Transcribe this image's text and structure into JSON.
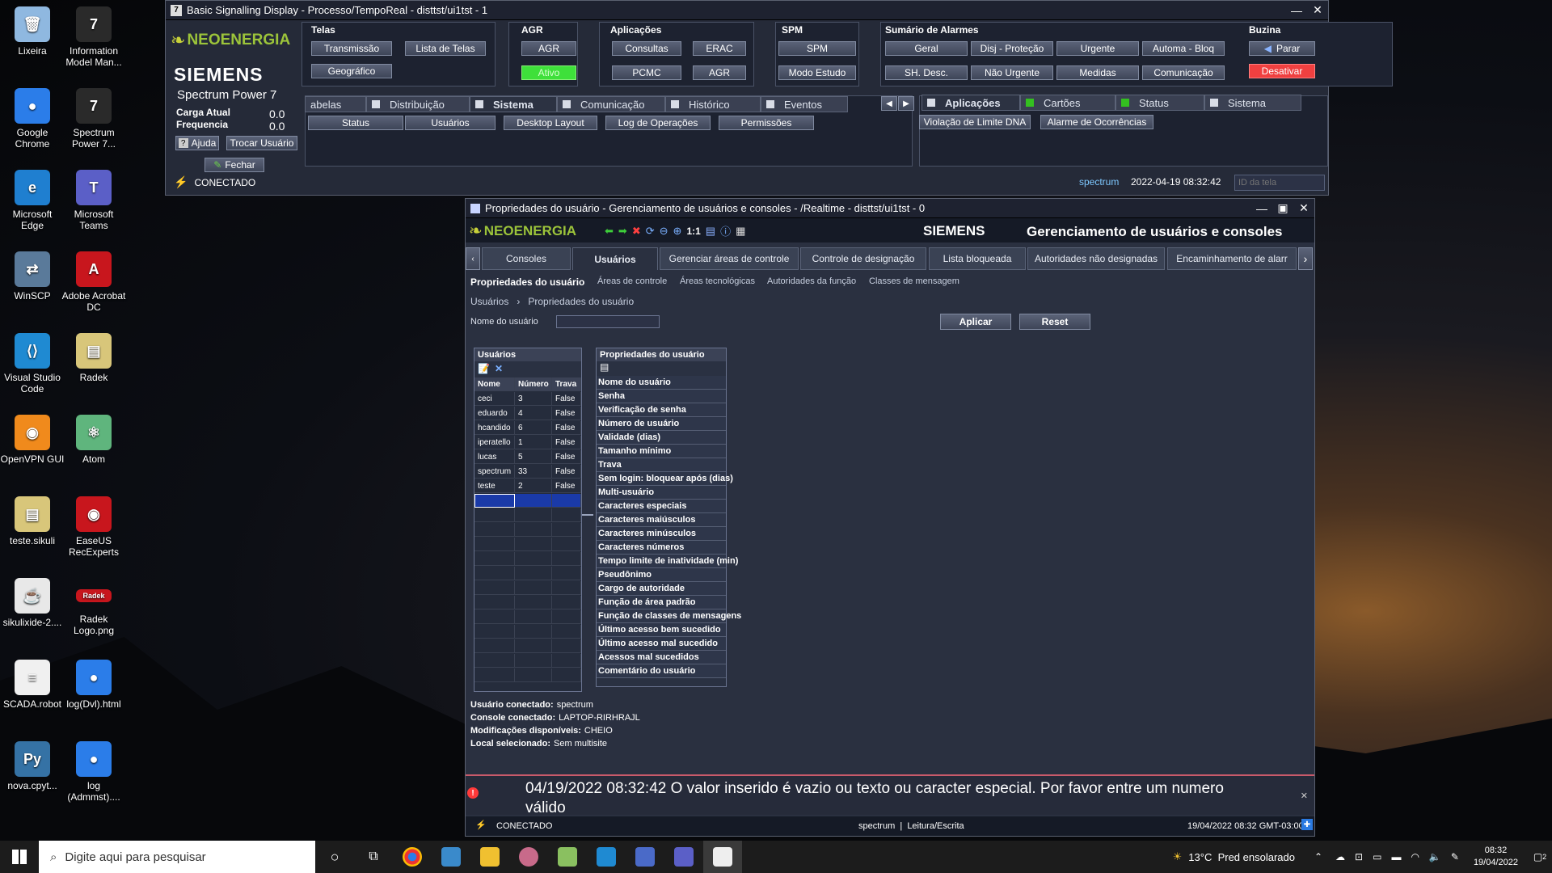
{
  "desktop": {
    "icons": [
      {
        "label": "Lixeira",
        "color": "#8fb8e0",
        "glyph": "🗑"
      },
      {
        "label": "Information Model Man...",
        "color": "#2a2a2a",
        "glyph": "7"
      },
      {
        "label": "Google Chrome",
        "color": "#2b7de9",
        "glyph": "●"
      },
      {
        "label": "Spectrum Power 7...",
        "color": "#2a2a2a",
        "glyph": "7"
      },
      {
        "label": "Microsoft Edge",
        "color": "#1f7fd0",
        "glyph": "e"
      },
      {
        "label": "Microsoft Teams",
        "color": "#5b5fc7",
        "glyph": "T"
      },
      {
        "label": "WinSCP",
        "color": "#5a7a9a",
        "glyph": "⇄"
      },
      {
        "label": "Adobe Acrobat DC",
        "color": "#c8161d",
        "glyph": "A"
      },
      {
        "label": "Visual Studio Code",
        "color": "#1f8ad2",
        "glyph": "⟨⟩"
      },
      {
        "label": "Radek",
        "color": "#d8c67a",
        "glyph": "▤"
      },
      {
        "label": "OpenVPN GUI",
        "color": "#f08a1c",
        "glyph": "◉"
      },
      {
        "label": "Atom",
        "color": "#5fb57d",
        "glyph": "⚛"
      },
      {
        "label": "teste.sikuli",
        "color": "#d8c67a",
        "glyph": "▤"
      },
      {
        "label": "EaseUS RecExperts",
        "color": "#c8161d",
        "glyph": "◉"
      },
      {
        "label": "sikulixide-2....",
        "color": "#e8e8e8",
        "glyph": "☕"
      },
      {
        "label": "Radek Logo.png",
        "color": "#c8161d",
        "glyph": "Radek"
      },
      {
        "label": "SCADA.robot",
        "color": "#f0f0f0",
        "glyph": "≡"
      },
      {
        "label": "log(Dvl).html",
        "color": "#2b7de9",
        "glyph": "●"
      },
      {
        "label": "nova.cpyt...",
        "color": "#3572a5",
        "glyph": "Py"
      },
      {
        "label": "log (Admmst)....",
        "color": "#2b7de9",
        "glyph": "●"
      }
    ]
  },
  "win1": {
    "title": "Basic Signalling Display - Processo/TempoReal - disttst/ui1tst - 1",
    "brand": "NEOENERGIA",
    "siemens": "SIEMENS",
    "product": "Spectrum Power 7",
    "carga_label": "Carga Atual",
    "carga_value": "0.0",
    "freq_label": "Frequencia",
    "freq_value": "0.0",
    "ajuda": "Ajuda",
    "trocar": "Trocar Usuário",
    "fechar": "Fechar",
    "groups": {
      "telas": "Telas",
      "agr": "AGR",
      "aplicacoes": "Aplicações",
      "spm": "SPM",
      "alarmes": "Sumário de Alarmes",
      "buzina": "Buzina"
    },
    "buttons": {
      "transmissao": "Transmissão",
      "lista_telas": "Lista de Telas",
      "geografico": "Geográfico",
      "agr": "AGR",
      "ativo": "Ativo",
      "consultas": "Consultas",
      "erac": "ERAC",
      "pcmc": "PCMC",
      "agr2": "AGR",
      "spm": "SPM",
      "modo_estudo": "Modo Estudo",
      "geral": "Geral",
      "disj": "Disj - Proteção",
      "urgente": "Urgente",
      "automa": "Automa - Bloq",
      "sh_desc": "SH. Desc.",
      "nao_urgente": "Não Urgente",
      "medidas": "Medidas",
      "comunicacao": "Comunicação",
      "parar": "Parar",
      "desativar": "Desativar"
    },
    "tabs_left": [
      "abelas",
      "Distribuição",
      "Sistema",
      "Comunicação",
      "Histórico",
      "Eventos"
    ],
    "subbtns_left": [
      "Status",
      "Usuários",
      "Desktop Layout",
      "Log de Operações",
      "Permissões"
    ],
    "tabs_right": [
      "Aplicações",
      "Cartões",
      "Status",
      "Sistema"
    ],
    "subbtns_right": [
      "Violação de Limite DNA",
      "Alarme de Ocorrências"
    ],
    "status": "CONECTADO",
    "user": "spectrum",
    "datetime": "2022-04-19 08:32:42",
    "id_placeholder": "ID da tela"
  },
  "win2": {
    "title": "Propriedades do usuário - Gerenciamento de usuários e consoles - /Realtime - disttst/ui1tst - 0",
    "brand": "NEOENERGIA",
    "zoom": "1:1",
    "siemens": "SIEMENS",
    "header": "Gerenciamento de usuários e consoles",
    "tabs": [
      "Consoles",
      "Usuários",
      "Gerenciar áreas de controle",
      "Controle de designação",
      "Lista bloqueada",
      "Autoridades não designadas",
      "Encaminhamento de alarr"
    ],
    "subtabs": [
      "Propriedades do usuário",
      "Áreas de controle",
      "Áreas tecnológicas",
      "Autoridades da função",
      "Classes de mensagem"
    ],
    "breadcrumb": [
      "Usuários",
      "Propriedades do usuário"
    ],
    "nome_label": "Nome do usuário",
    "nome_value": "",
    "aplicar": "Aplicar",
    "reset": "Reset",
    "users_title": "Usuários",
    "users_cols": [
      "Nome",
      "Número",
      "Trava"
    ],
    "users": [
      [
        "ceci",
        "3",
        "False"
      ],
      [
        "eduardo",
        "4",
        "False"
      ],
      [
        "hcandido",
        "6",
        "False"
      ],
      [
        "iperatello",
        "1",
        "False"
      ],
      [
        "lucas",
        "5",
        "False"
      ],
      [
        "spectrum",
        "33",
        "False"
      ],
      [
        "teste",
        "2",
        "False"
      ]
    ],
    "props_title": "Propriedades do usuário",
    "props": [
      "Nome do usuário",
      "Senha",
      "Verificação de senha",
      "Número de usuário",
      "Validade (dias)",
      "Tamanho mínimo",
      "Trava",
      "Sem login: bloquear após (dias)",
      "Multi-usuário",
      "Caracteres especiais",
      "Caracteres maiúsculos",
      "Caracteres minúsculos",
      "Caracteres números",
      "Tempo limite de inatividade (min)",
      "Pseudônimo",
      "Cargo de autoridade",
      "Função de área padrão",
      "Função de classes de mensagens",
      "Último acesso bem sucedido",
      "Último acesso mal sucedido",
      "Acessos mal sucedidos",
      "Comentário do usuário"
    ],
    "info": [
      [
        "Usuário conectado:",
        "spectrum"
      ],
      [
        "Console conectado:",
        "LAPTOP-RIRHRAJL"
      ],
      [
        "Modificações disponíveis:",
        "CHEIO"
      ],
      [
        "Local selecionado:",
        "Sem multisite"
      ]
    ],
    "message": "04/19/2022 08:32:42 O valor inserido é vazio ou texto ou caracter especial. Por favor entre um numero válido",
    "status": "CONECTADO",
    "status_user": "spectrum  |  Leitura/Escrita",
    "status_time": "19/04/2022 08:32 GMT-03:00"
  },
  "taskbar": {
    "search": "Digite aqui para pesquisar",
    "weather": "13°C  Pred ensolarado",
    "time": "08:32",
    "date": "19/04/2022",
    "notif": "2"
  }
}
